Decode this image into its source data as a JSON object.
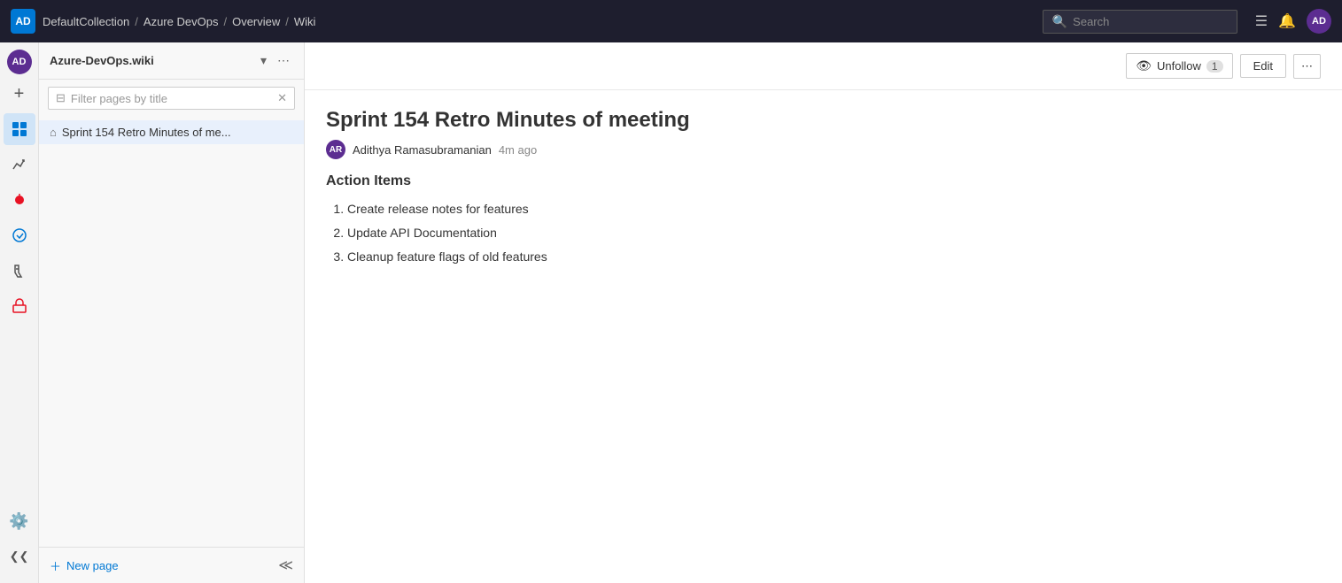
{
  "topbar": {
    "logo_text": "AD",
    "breadcrumb": [
      {
        "label": "DefaultCollection",
        "href": "#"
      },
      {
        "label": "Azure DevOps",
        "href": "#"
      },
      {
        "label": "Overview",
        "href": "#"
      },
      {
        "label": "Wiki",
        "href": "#"
      }
    ],
    "search_placeholder": "Search",
    "icons": [
      "list-icon",
      "book-icon"
    ],
    "avatar_text": "AD"
  },
  "sidebar": {
    "wiki_title": "Azure-DevOps.wiki",
    "filter_placeholder": "Filter pages by title",
    "pages": [
      {
        "label": "Sprint 154 Retro Minutes of me...",
        "icon": "home"
      }
    ],
    "new_page_label": "New page"
  },
  "content": {
    "page_title": "Sprint 154 Retro Minutes of meeting",
    "author": "Adithya Ramasubramanian",
    "time_ago": "4m ago",
    "unfollow_label": "Unfollow",
    "follow_count": "1",
    "edit_label": "Edit",
    "section_heading": "Action Items",
    "action_items": [
      "Create release notes for features",
      "Update API Documentation",
      "Cleanup feature flags of old features"
    ]
  },
  "rail": {
    "items": [
      {
        "icon": "📋",
        "name": "boards-icon"
      },
      {
        "icon": "📊",
        "name": "analytics-icon"
      },
      {
        "icon": "🔴",
        "name": "bugs-icon"
      },
      {
        "icon": "🔷",
        "name": "devops-icon"
      },
      {
        "icon": "🧪",
        "name": "test-icon"
      },
      {
        "icon": "📦",
        "name": "artifacts-icon"
      }
    ],
    "settings_icon": "⚙️"
  }
}
